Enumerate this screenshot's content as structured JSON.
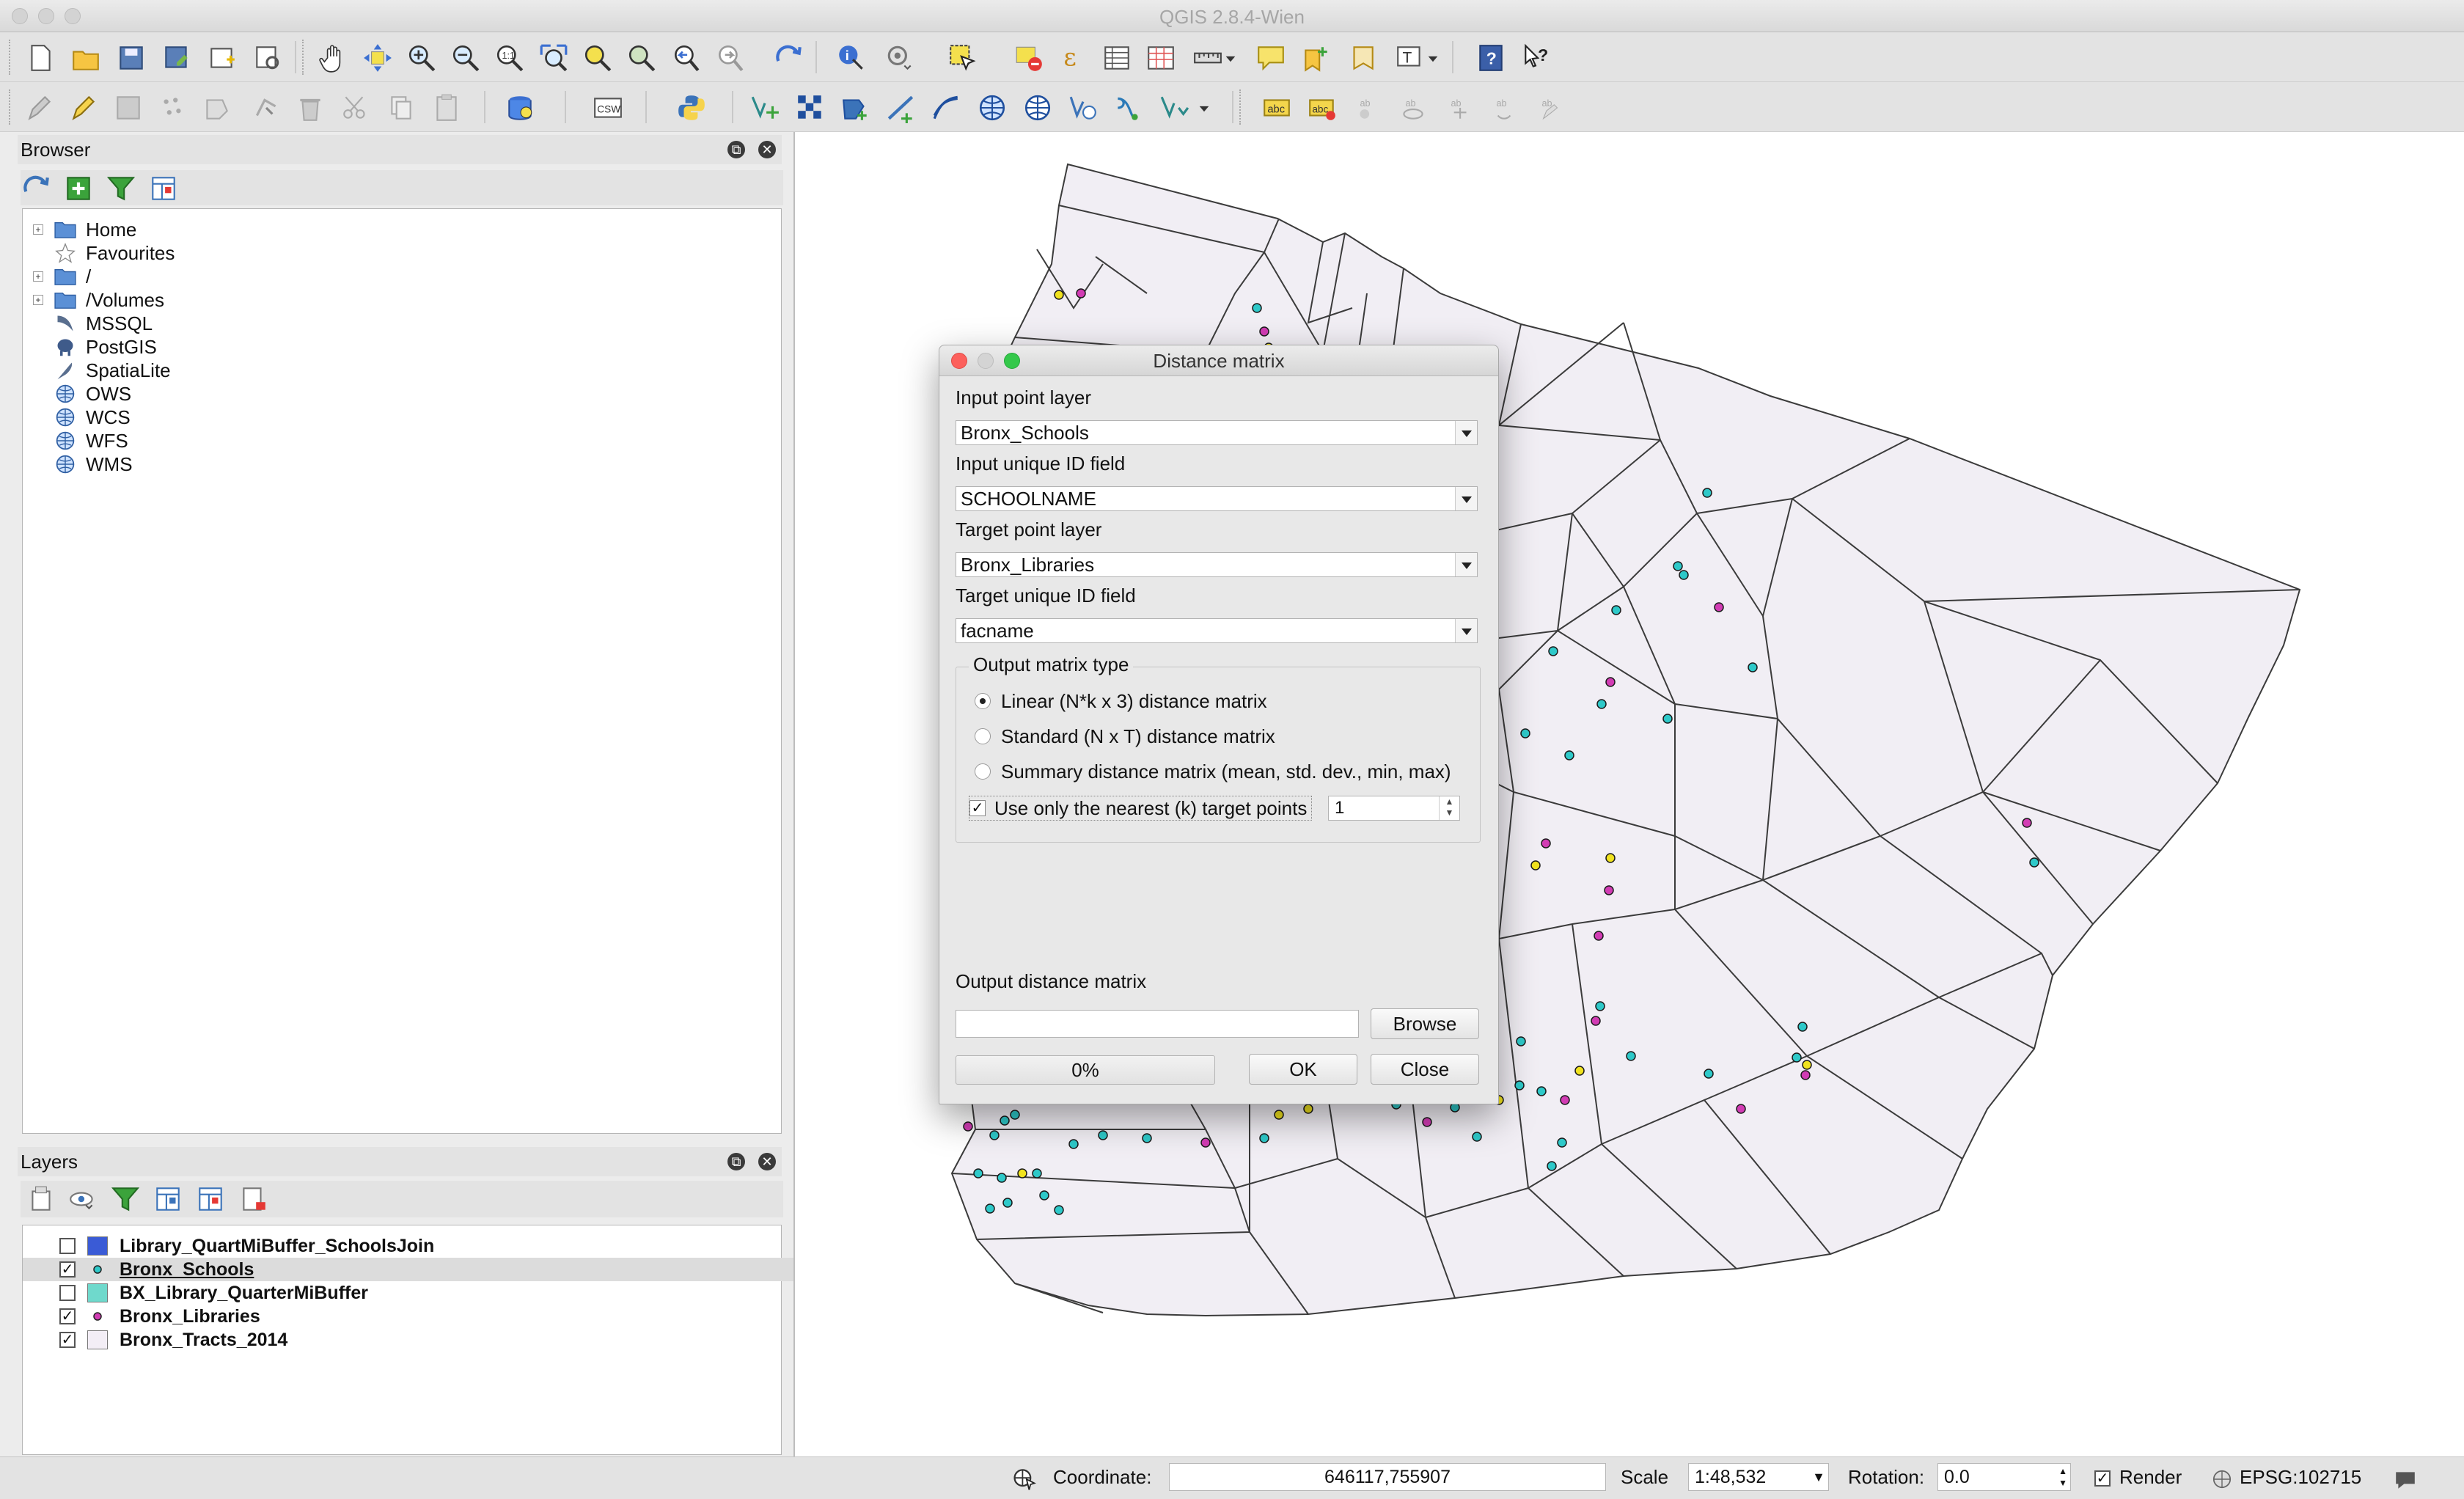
{
  "app": {
    "title": "QGIS 2.8.4-Wien"
  },
  "browser_panel": {
    "title": "Browser",
    "items": [
      {
        "label": "Home",
        "icon": "folder-icon",
        "expandable": true
      },
      {
        "label": "Favourites",
        "icon": "star-icon",
        "expandable": false
      },
      {
        "label": "/",
        "icon": "folder-icon",
        "expandable": true
      },
      {
        "label": "/Volumes",
        "icon": "folder-icon",
        "expandable": true
      },
      {
        "label": "MSSQL",
        "icon": "mssql-icon",
        "expandable": false
      },
      {
        "label": "PostGIS",
        "icon": "postgis-elephant-icon",
        "expandable": false
      },
      {
        "label": "SpatiaLite",
        "icon": "spatialite-feather-icon",
        "expandable": false
      },
      {
        "label": "OWS",
        "icon": "globe-icon",
        "expandable": false
      },
      {
        "label": "WCS",
        "icon": "globe-icon",
        "expandable": false
      },
      {
        "label": "WFS",
        "icon": "globe-icon",
        "expandable": false
      },
      {
        "label": "WMS",
        "icon": "globe-icon",
        "expandable": false
      }
    ]
  },
  "layers_panel": {
    "title": "Layers",
    "layers": [
      {
        "name": "Library_QuartMiBuffer_SchoolsJoin",
        "checked": false,
        "symbol": "fill",
        "color": "#3a5bd6"
      },
      {
        "name": "Bronx_Schools",
        "checked": true,
        "symbol": "point",
        "color": "#2ec9c9",
        "selected": true
      },
      {
        "name": "BX_Library_QuarterMiBuffer",
        "checked": false,
        "symbol": "fill",
        "color": "#6fd9cc"
      },
      {
        "name": "Bronx_Libraries",
        "checked": true,
        "symbol": "point",
        "color": "#d23cb4"
      },
      {
        "name": "Bronx_Tracts_2014",
        "checked": true,
        "symbol": "fill",
        "color": "#f3eef6"
      }
    ]
  },
  "dialog": {
    "title": "Distance matrix",
    "input_point_layer_label": "Input point layer",
    "input_point_layer_value": "Bronx_Schools",
    "input_id_label": "Input unique ID field",
    "input_id_value": "SCHOOLNAME",
    "target_point_layer_label": "Target point layer",
    "target_point_layer_value": "Bronx_Libraries",
    "target_id_label": "Target unique ID field",
    "target_id_value": "facname",
    "matrix_type_label": "Output matrix type",
    "options": [
      {
        "label": "Linear (N*k x 3) distance matrix",
        "selected": true
      },
      {
        "label": "Standard (N x T) distance matrix",
        "selected": false
      },
      {
        "label": "Summary distance matrix (mean, std. dev., min, max)",
        "selected": false
      }
    ],
    "nearest_label": "Use only the nearest (k) target points",
    "nearest_checked": true,
    "nearest_k": "1",
    "output_label": "Output distance matrix",
    "output_value": "",
    "browse_label": "Browse",
    "progress": "0%",
    "ok_label": "OK",
    "close_label": "Close"
  },
  "statusbar": {
    "coordinate_label": "Coordinate:",
    "coordinate_value": "646117,755907",
    "scale_label": "Scale",
    "scale_value": "1:48,532",
    "rotation_label": "Rotation:",
    "rotation_value": "0.0",
    "render_label": "Render",
    "render_checked": true,
    "crs": "EPSG:102715"
  },
  "colors": {
    "school_point": "#2ec9c9",
    "library_point": "#d23cb4",
    "extra_point": "#f0e21e",
    "tract_fill": "#f1eef4",
    "tract_stroke": "#3b3b3b"
  }
}
